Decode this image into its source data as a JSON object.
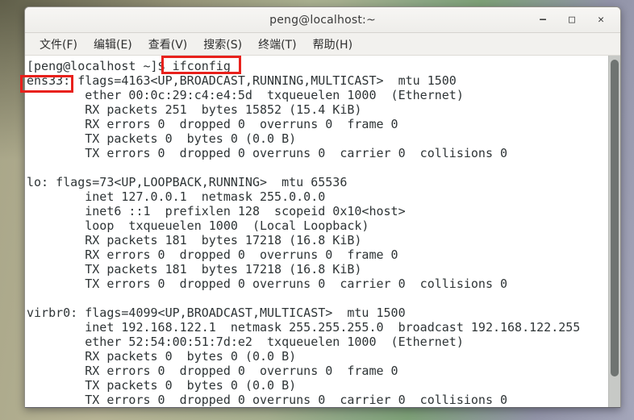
{
  "window": {
    "title": "peng@localhost:~",
    "controls": {
      "minimize": "–",
      "maximize": "□",
      "close": "✕"
    }
  },
  "menu": {
    "items": [
      {
        "label": "文件(F)"
      },
      {
        "label": "编辑(E)"
      },
      {
        "label": "查看(V)"
      },
      {
        "label": "搜索(S)"
      },
      {
        "label": "终端(T)"
      },
      {
        "label": "帮助(H)"
      }
    ]
  },
  "terminal": {
    "prompt": "[peng@localhost ~]$",
    "command": "ifconfig",
    "lines": [
      "[peng@localhost ~]$ ifconfig",
      "ens33: flags=4163<UP,BROADCAST,RUNNING,MULTICAST>  mtu 1500",
      "        ether 00:0c:29:c4:e4:5d  txqueuelen 1000  (Ethernet)",
      "        RX packets 251  bytes 15852 (15.4 KiB)",
      "        RX errors 0  dropped 0  overruns 0  frame 0",
      "        TX packets 0  bytes 0 (0.0 B)",
      "        TX errors 0  dropped 0 overruns 0  carrier 0  collisions 0",
      "",
      "lo: flags=73<UP,LOOPBACK,RUNNING>  mtu 65536",
      "        inet 127.0.0.1  netmask 255.0.0.0",
      "        inet6 ::1  prefixlen 128  scopeid 0x10<host>",
      "        loop  txqueuelen 1000  (Local Loopback)",
      "        RX packets 181  bytes 17218 (16.8 KiB)",
      "        RX errors 0  dropped 0  overruns 0  frame 0",
      "        TX packets 181  bytes 17218 (16.8 KiB)",
      "        TX errors 0  dropped 0 overruns 0  carrier 0  collisions 0",
      "",
      "virbr0: flags=4099<UP,BROADCAST,MULTICAST>  mtu 1500",
      "        inet 192.168.122.1  netmask 255.255.255.0  broadcast 192.168.122.255",
      "        ether 52:54:00:51:7d:e2  txqueuelen 1000  (Ethernet)",
      "        RX packets 0  bytes 0 (0.0 B)",
      "        RX errors 0  dropped 0  overruns 0  frame 0",
      "        TX packets 0  bytes 0 (0.0 B)",
      "        TX errors 0  dropped 0 overruns 0  carrier 0  collisions 0"
    ]
  },
  "annotations": {
    "color": "#e8211c",
    "boxes": [
      {
        "target": "ifconfig"
      },
      {
        "target": "ens33:"
      }
    ]
  }
}
